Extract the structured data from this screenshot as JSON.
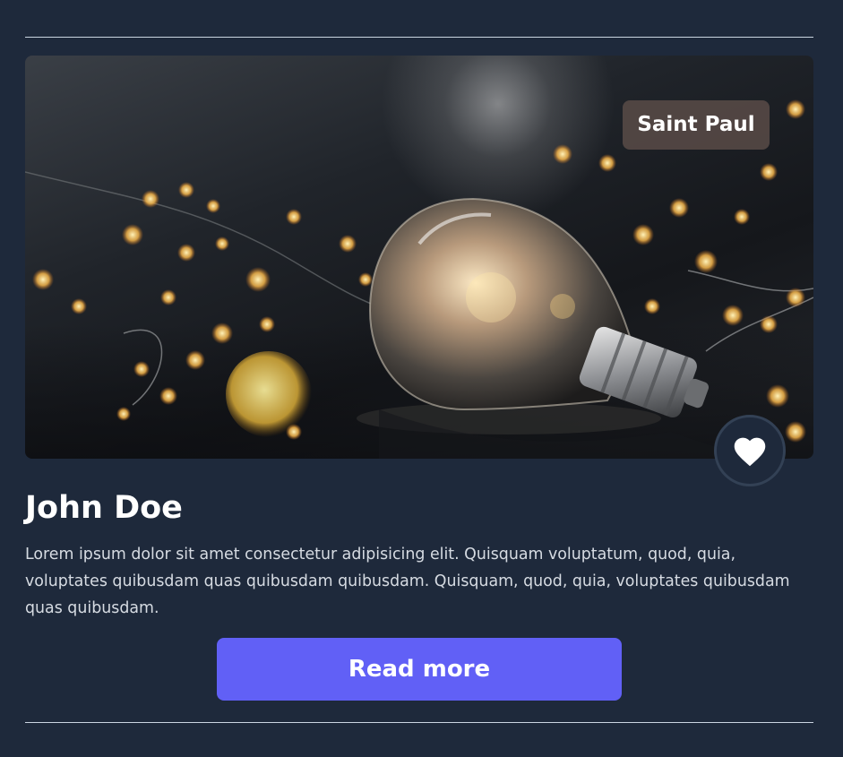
{
  "card": {
    "image_alt": "Light bulb lying among glowing string lights",
    "location_badge": "Saint Paul",
    "like_icon": "heart-icon",
    "title": "John Doe",
    "description": "Lorem ipsum dolor sit amet consectetur adipisicing elit. Quisquam voluptatum, quod, quia, voluptates quibusdam quas quibusdam quibusdam. Quisquam, quod, quia, voluptates quibusdam quas quibusdam.",
    "button_label": "Read more"
  },
  "colors": {
    "background": "#1e293b",
    "accent": "#6160f6",
    "divider": "#cbd5e1",
    "text": "#ffffff",
    "muted_text": "#d6dbe2"
  }
}
